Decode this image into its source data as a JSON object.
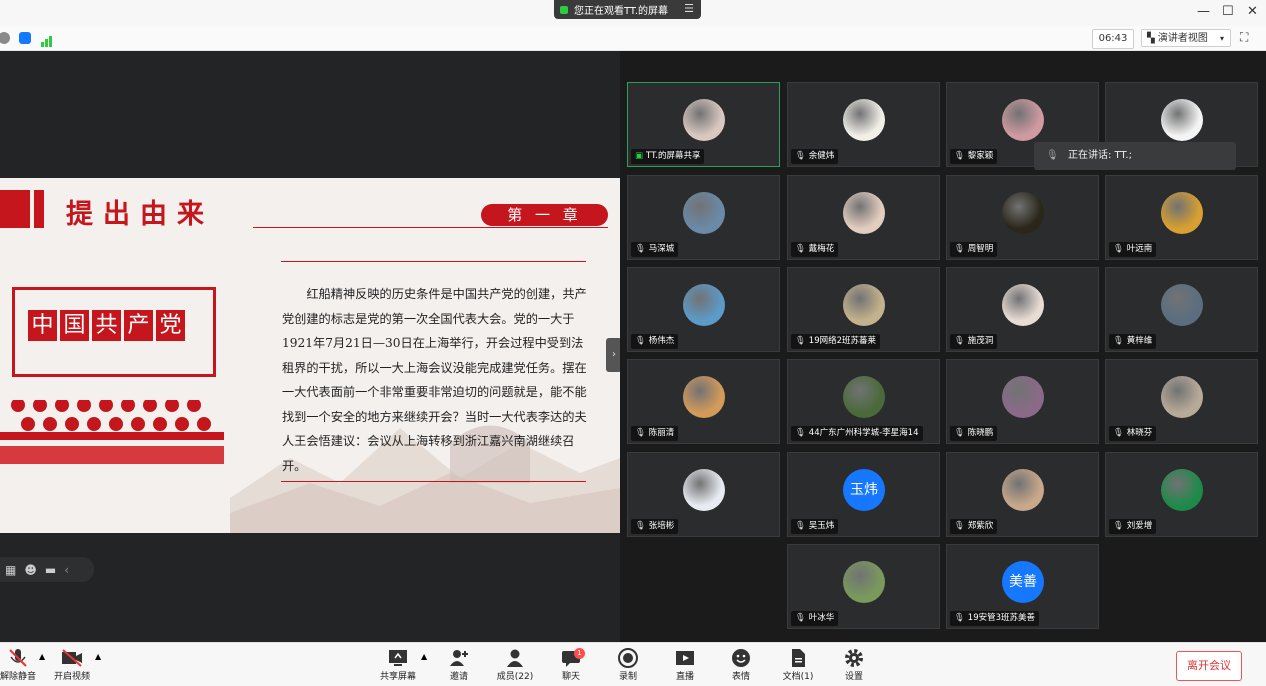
{
  "titlebar": {
    "viewing": "您正在观看TT.的屏幕",
    "menu_icon": "list-icon",
    "controls": [
      "—",
      "☐",
      "✕"
    ]
  },
  "topbar": {
    "timer": "06:43",
    "view_mode": "演讲者视图"
  },
  "slide": {
    "title": "提出由来",
    "chapter": "第 一 章",
    "badge_chars": [
      "中",
      "国",
      "共",
      "产",
      "党"
    ],
    "paragraph": "红船精神反映的历史条件是中国共产党的创建，共产党创建的标志是党的第一次全国代表大会。党的一大于1921年7月21日—30日在上海举行，开会过程中受到法租界的干扰，所以一大上海会议没能完成建党任务。摆在一大代表面前一个非常重要非常迫切的问题就是，能不能找到一个安全的地方来继续开会？当时一大代表李达的夫人王会悟建议：会议从上海转移到浙江嘉兴南湖继续召开。"
  },
  "speaking": "正在讲话: TT.;",
  "participants": [
    {
      "name": "TT.的屏幕共享",
      "active": true,
      "color": "#d9c8bf"
    },
    {
      "name": "余健炜",
      "color": "#f2efe8"
    },
    {
      "name": "黎家颖",
      "color": "#cf9aa0"
    },
    {
      "name": "",
      "color": "#f4f4f4"
    },
    {
      "name": "马深城",
      "color": "#6a8aa8"
    },
    {
      "name": "戴梅花",
      "color": "#e3cdbf"
    },
    {
      "name": "周智明",
      "color": "#2a2618"
    },
    {
      "name": "叶远南",
      "color": "#d8a030"
    },
    {
      "name": "杨伟杰",
      "color": "#5c9ac8"
    },
    {
      "name": "19网络2班苏蕃莱",
      "color": "#c4b28c"
    },
    {
      "name": "施茂洞",
      "color": "#e8dcd4"
    },
    {
      "name": "黄梓维",
      "color": "#5a6e80"
    },
    {
      "name": "陈丽清",
      "color": "#d49a5a"
    },
    {
      "name": "44广东广州科学城-李星海14",
      "color": "#4a6a3a"
    },
    {
      "name": "陈晓鹏",
      "color": "#8a6a88"
    },
    {
      "name": "林晓芬",
      "color": "#b8aa98"
    },
    {
      "name": "张培彬",
      "color": "#e8ecf2"
    },
    {
      "name": "吴玉炜",
      "text": "玉炜"
    },
    {
      "name": "郑紫欣",
      "color": "#c8a88a"
    },
    {
      "name": "刘爱增",
      "color": "#1e8a4a"
    },
    {
      "name": "叶冰华",
      "color": "#7a9a5c"
    },
    {
      "name": "19安管3班苏美善",
      "text": "美善"
    }
  ],
  "bottombar": {
    "mute": "解除静音",
    "video": "开启视频",
    "share": "共享屏幕",
    "invite": "邀请",
    "members": "成员(22)",
    "chat": "聊天",
    "chat_badge": "1",
    "record": "录制",
    "live": "直播",
    "emoji": "表情",
    "docs": "文档(1)",
    "settings": "设置",
    "leave": "离开会议"
  }
}
